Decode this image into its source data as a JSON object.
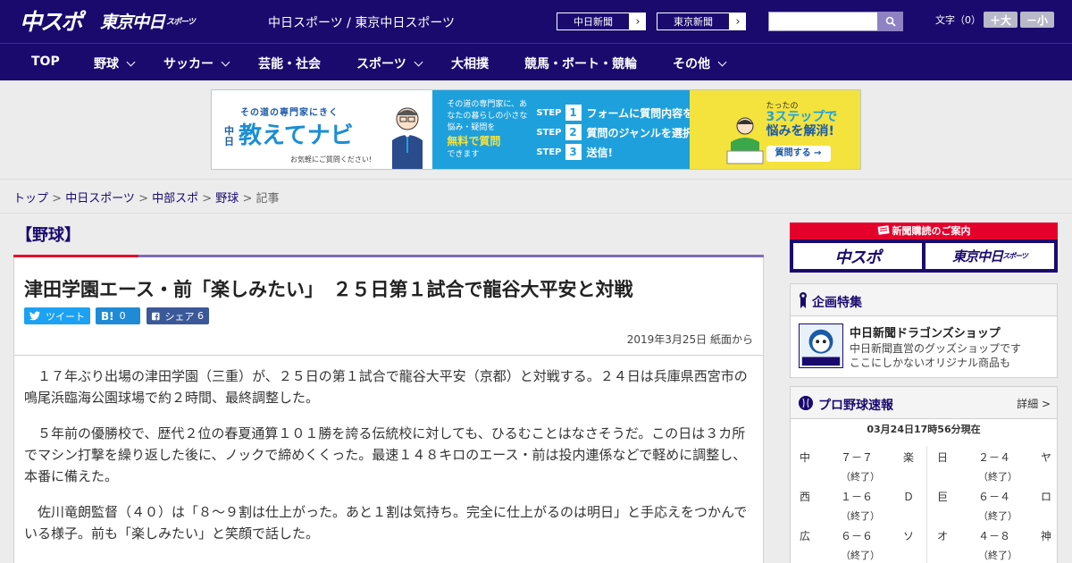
{
  "header": {
    "logo_main": "中スポ",
    "logo_tokyo": "東京中日",
    "logo_tokyo_suffix": "スポーツ",
    "site_name": "中日スポーツ / 東京中日スポーツ",
    "btn_chunichi": "中日新聞",
    "btn_tokyo": "東京新聞",
    "search_placeholder": "",
    "font_size_label": "文字（0）",
    "font_plus": "＋大",
    "font_minus": "－小"
  },
  "nav": {
    "items": [
      {
        "label": "TOP"
      },
      {
        "label": "野球"
      },
      {
        "label": "サッカー"
      },
      {
        "label": "芸能・社会"
      },
      {
        "label": "スポーツ"
      },
      {
        "label": "大相撲"
      },
      {
        "label": "競馬・ボート・競輪"
      },
      {
        "label": "その他"
      }
    ]
  },
  "banner": {
    "tagline": "その道の専門家にきく",
    "chu": "中日",
    "title": "教えてナビ",
    "foot": "お気軽にご質問ください!",
    "mid_text_1": "その道の専門家に、あなたの暮らしの小さな悩み・疑問を",
    "mid_highlight": "無料で質問",
    "mid_text_2": "できます",
    "step_label": "STEP",
    "steps": [
      {
        "num": "1",
        "text": "フォームに質問内容を入力"
      },
      {
        "num": "2",
        "text": "質問のジャンルを選択"
      },
      {
        "num": "3",
        "text": "送信!"
      }
    ],
    "right_top": "たったの",
    "right_big_1": "3ステップで",
    "right_big_2": "悩みを解消!",
    "cta": "質問する →"
  },
  "breadcrumb": {
    "items": [
      "トップ",
      "中日スポーツ",
      "中部スポ",
      "野球"
    ],
    "sep": " > ",
    "current": "記事"
  },
  "article": {
    "category": "【野球】",
    "title": "津田学園エース・前「楽しみたい」　２５日第１試合で龍谷大平安と対戦",
    "tweet": "ツイート",
    "hatena_icon": "B!",
    "hatena_count": "0",
    "fb_label": "シェア",
    "fb_count": "6",
    "date": "2019年3月25日 紙面から",
    "paragraphs": [
      "１７年ぶり出場の津田学園（三重）が、２５日の第１試合で龍谷大平安（京都）と対戦する。２４日は兵庫県西宮市の鳴尾浜臨海公園球場で約２時間、最終調整した。",
      "５年前の優勝校で、歴代２位の春夏通算１０１勝を誇る伝統校に対しても、ひるむことはなさそうだ。この日は３カ所でマシン打撃を繰り返した後に、ノックで締めくくった。最速１４８キロのエース・前は投内連係などで軽めに調整し、本番に備えた。",
      "佐川竜朗監督（４０）は「８～９割は仕上がった。あと１割は気持ち。完全に仕上がるのは明日」と手応えをつかんでいる様子。前も「楽しみたい」と笑顔で話した。"
    ]
  },
  "sidebar": {
    "subscription_head": "新聞購読のご案内",
    "sub_logo_a": "中スポ",
    "sub_logo_b": "東京中日",
    "sub_logo_b_suffix": "スポーツ",
    "feature_title": "企画特集",
    "shop_title": "中日新聞ドラゴンズショップ",
    "shop_desc_1": "中日新聞直営のグッズショップです",
    "shop_desc_2": "ここにしかないオリジナル商品も",
    "baseball_title": "プロ野球速報",
    "baseball_more": "詳細 >",
    "baseball_updated": "03月24日17時56分現在",
    "games_left": [
      {
        "home": "中",
        "score": "７－７",
        "away": "楽",
        "status": "（終了）"
      },
      {
        "home": "西",
        "score": "１－６",
        "away": "Ｄ",
        "status": "（終了）"
      },
      {
        "home": "広",
        "score": "６－６",
        "away": "ソ",
        "status": "（終了）"
      }
    ],
    "games_right": [
      {
        "home": "日",
        "score": "２－４",
        "away": "ヤ",
        "status": "（終了）"
      },
      {
        "home": "巨",
        "score": "６－４",
        "away": "ロ",
        "status": "（終了）"
      },
      {
        "home": "オ",
        "score": "４－８",
        "away": "神",
        "status": "（終了）"
      }
    ]
  },
  "colors": {
    "brand_navy": "#1a0a6e",
    "accent_red": "#e4002b",
    "accent_purple": "#7d6cb6"
  }
}
